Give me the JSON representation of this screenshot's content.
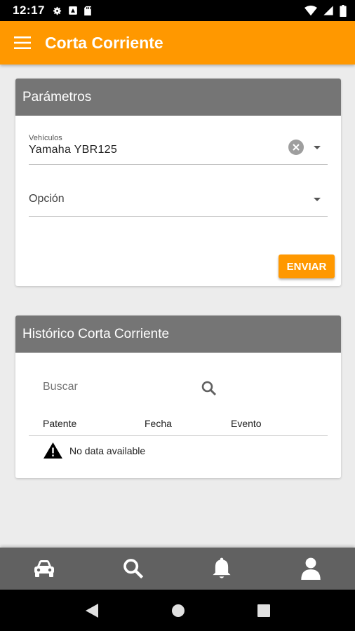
{
  "status_bar": {
    "time": "12:17"
  },
  "app_bar": {
    "title": "Corta Corriente"
  },
  "params_card": {
    "title": "Parámetros",
    "vehicle_label": "Vehículos",
    "vehicle_value": "Yamaha YBR125",
    "option_label": "Opción",
    "send_button": "ENVIAR"
  },
  "history_card": {
    "title": "Histórico Corta Corriente",
    "search_placeholder": "Buscar",
    "columns": [
      "Patente",
      "Fecha",
      "Evento"
    ],
    "empty_message": "No data available"
  },
  "bottom_nav": {
    "items": [
      "car-icon",
      "search-icon",
      "bell-icon",
      "person-icon"
    ]
  },
  "colors": {
    "primary": "#ff9800",
    "header_gray": "#757575",
    "bottom_nav": "#616161",
    "background": "#ececec"
  }
}
